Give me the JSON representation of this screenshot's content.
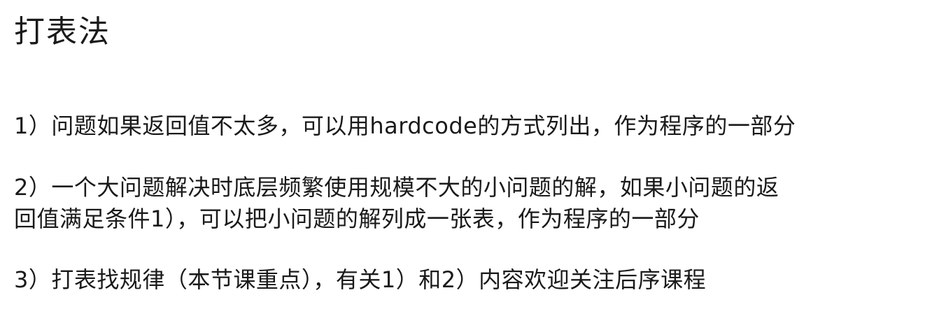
{
  "title": "打表法",
  "points": [
    "1）问题如果返回值不太多，可以用hardcode的方式列出，作为程序的一部分",
    [
      "2）一个大问题解决时底层频繁使用规模不大的小问题的解，如果小问题的返",
      "回值满足条件1），可以把小问题的解列成一张表，作为程序的一部分"
    ],
    "3）打表找规律（本节课重点），有关1）和2）内容欢迎关注后序课程"
  ]
}
